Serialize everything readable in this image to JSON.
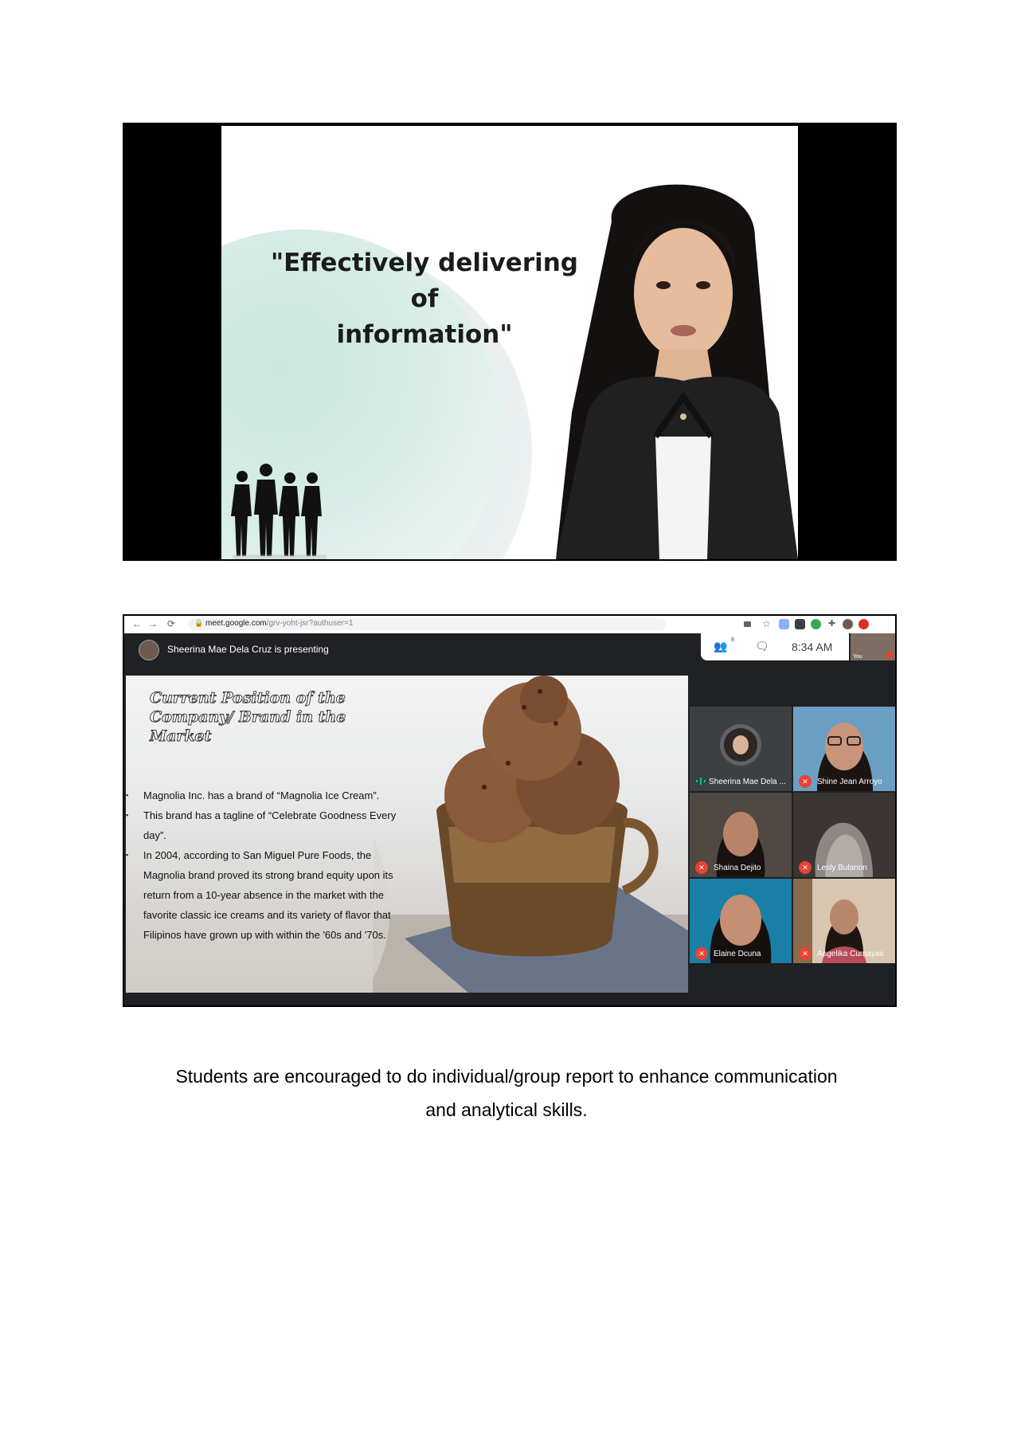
{
  "screenshot1": {
    "slide_quote_line1": "\"Effectively delivering of",
    "slide_quote_line2": "information\""
  },
  "meet": {
    "url_host": "meet.google.com",
    "url_path": "/grv-yoht-jsr?authuser=1",
    "presenting_banner": "Sheerina Mae Dela Cruz is presenting",
    "participant_count": "8",
    "time": "8:34 AM",
    "self_label": "You",
    "slide": {
      "title": "Current Position of the Company/ Brand in the Market",
      "bullets": [
        "Magnolia Inc. has a brand of “Magnolia Ice Cream”.",
        "This brand has a tagline of “Celebrate Goodness Every day”.",
        "In 2004, according to San Miguel Pure Foods, the Magnolia brand proved its strong brand equity upon its return from a 10-year absence in the market with the favorite classic ice creams and its variety of flavor that Filipinos have grown up with within the '60s and '70s."
      ]
    },
    "participants": [
      {
        "name": "Sheerina Mae Dela ...",
        "mic": "speaking"
      },
      {
        "name": "Shine Jean Arroyo",
        "mic": "muted"
      },
      {
        "name": "Shaina Dejito",
        "mic": "muted"
      },
      {
        "name": "Lesly Bulanon",
        "mic": "muted"
      },
      {
        "name": "Elaine Dcuna",
        "mic": "muted"
      },
      {
        "name": "Angelika Cumayas",
        "mic": "muted"
      }
    ],
    "colors": {
      "meet_bg": "#202124",
      "muted_red": "#ea4335",
      "speaking_teal": "#00bfa5"
    }
  },
  "caption": {
    "line1": "Students are encouraged to do individual/group report to enhance communication",
    "line2": "and analytical skills."
  }
}
